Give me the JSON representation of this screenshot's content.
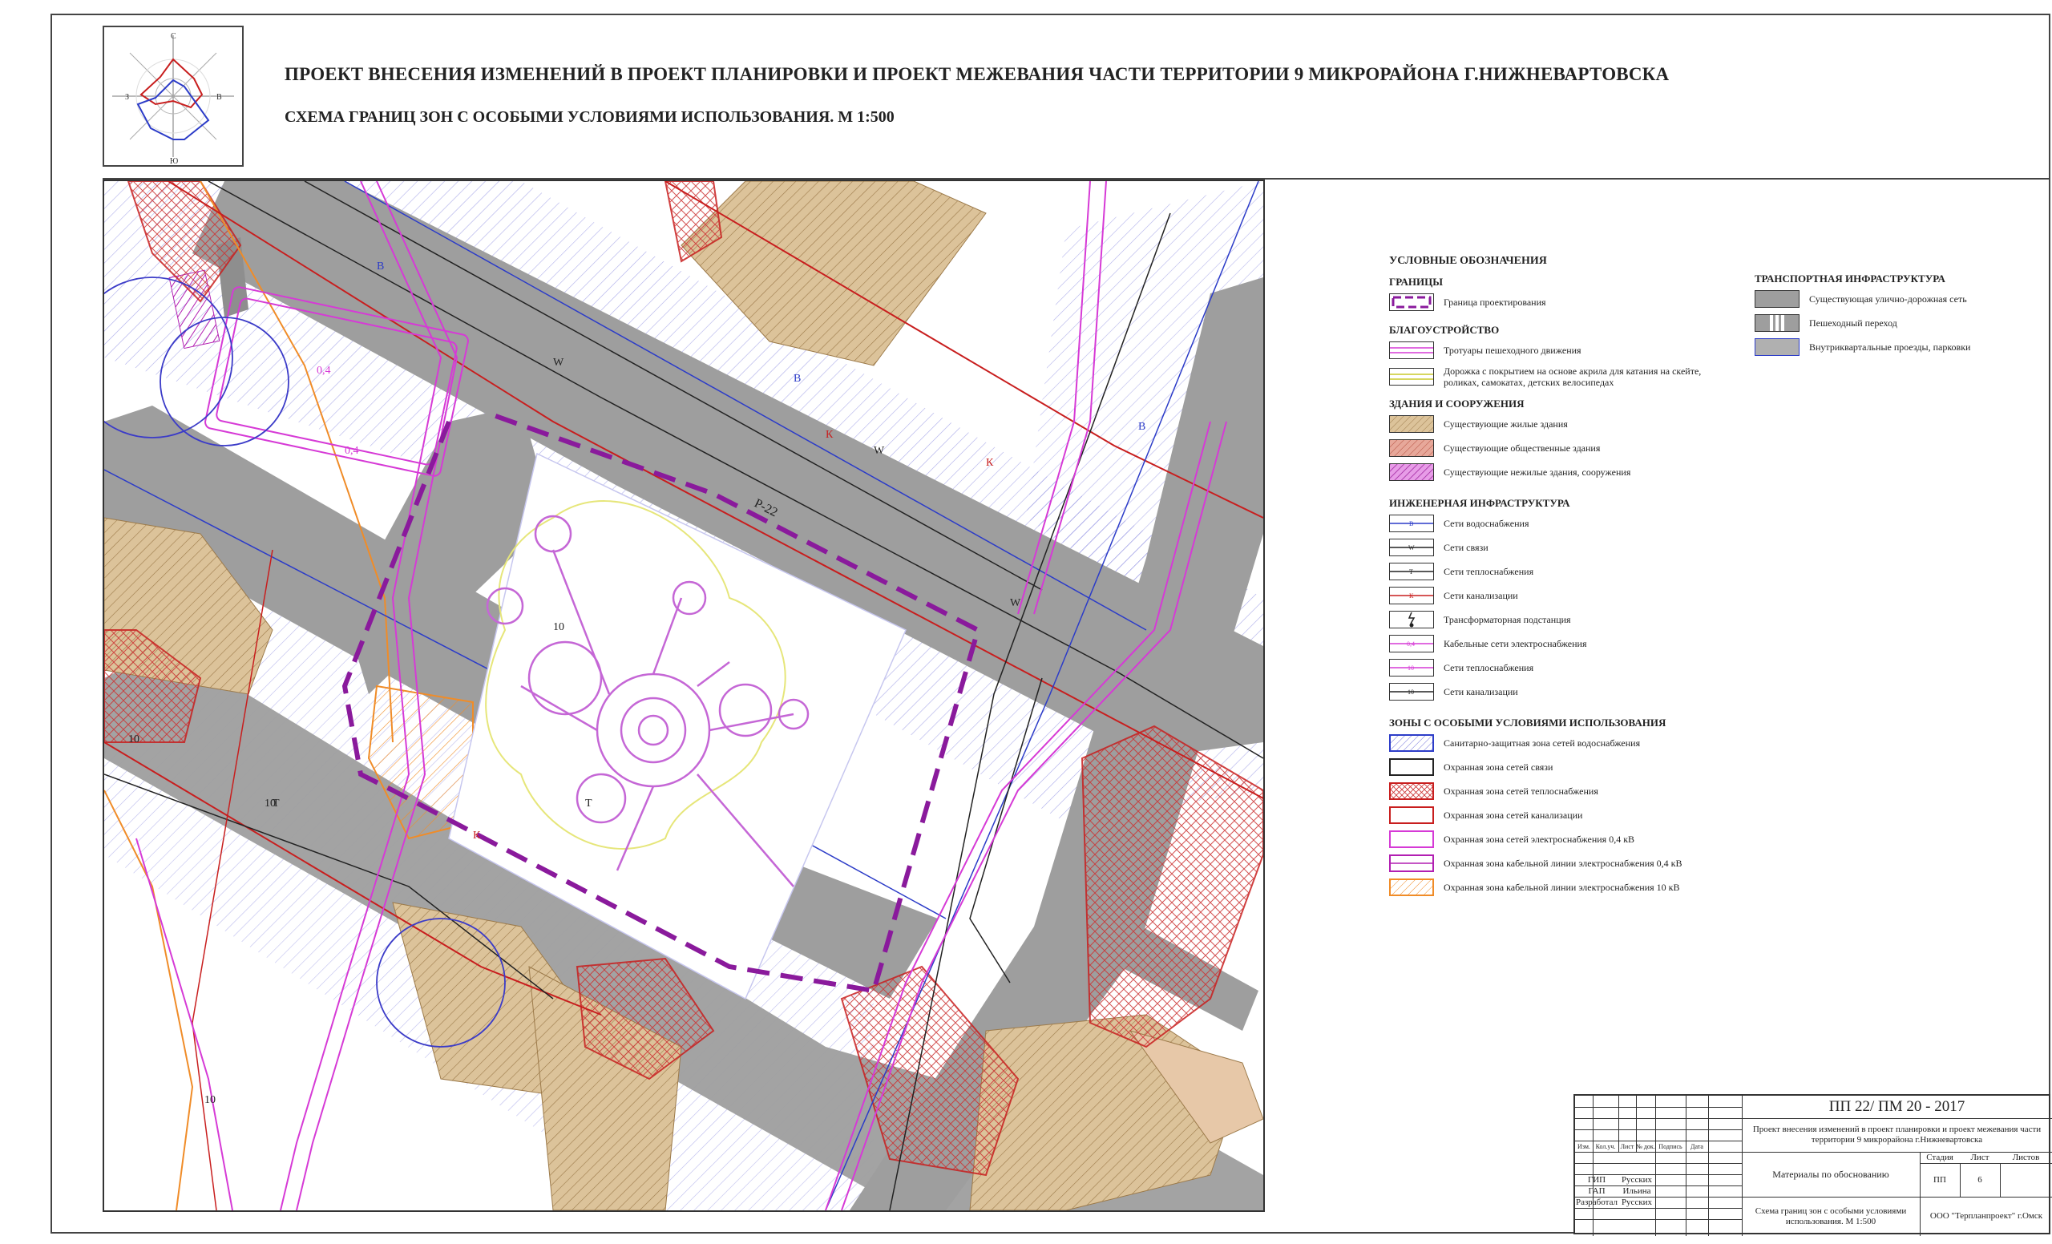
{
  "header": {
    "title": "ПРОЕКТ ВНЕСЕНИЯ ИЗМЕНЕНИЙ В ПРОЕКТ ПЛАНИРОВКИ И ПРОЕКТ МЕЖЕВАНИЯ ЧАСТИ ТЕРРИТОРИИ 9 МИКРОРАЙОНА Г.НИЖНЕВАРТОВСКА",
    "subtitle": "СХЕМА ГРАНИЦ ЗОН С ОСОБЫМИ УСЛОВИЯМИ ИСПОЛЬЗОВАНИЯ. М 1:500"
  },
  "compass": {
    "north": "С",
    "south": "Ю",
    "west": "З",
    "east": "В"
  },
  "map": {
    "street_label": "Р-22",
    "labels": {
      "water": "В",
      "comm": "W",
      "heat": "Т",
      "sewer": "К",
      "cable_04": "0,4",
      "cable_10": "10"
    }
  },
  "legend": {
    "title": "УСЛОВНЫЕ ОБОЗНАЧЕНИЯ",
    "sections": [
      {
        "heading": "ГРАНИЦЫ",
        "items": [
          {
            "label": "Граница проектирования",
            "swatch": "boundary"
          }
        ]
      },
      {
        "heading": "БЛАГОУСТРОЙСТВО",
        "items": [
          {
            "label": "Тротуары пешеходного движения",
            "swatch": "sidewalk"
          },
          {
            "label": "Дорожка с покрытием на основе акрила для катания на скейте, роликах, самокатах, детских велосипедах",
            "swatch": "acryl"
          }
        ]
      },
      {
        "heading": "ЗДАНИЯ И СООРУЖЕНИЯ",
        "items": [
          {
            "label": "Существующие жилые здания",
            "swatch": "residential"
          },
          {
            "label": "Существующие общественные здания",
            "swatch": "public"
          },
          {
            "label": "Существующие нежилые здания, сооружения",
            "swatch": "nonres"
          }
        ]
      },
      {
        "heading": "ИНЖЕНЕРНАЯ ИНФРАСТРУКТУРА",
        "items": [
          {
            "label": "Сети водоснабжения",
            "swatch": "line-water",
            "mark": "В"
          },
          {
            "label": "Сети связи",
            "swatch": "line-comm",
            "mark": "W"
          },
          {
            "label": "Сети теплоснабжения",
            "swatch": "line-heat",
            "mark": "Т"
          },
          {
            "label": "Сети канализации",
            "swatch": "line-sewer",
            "mark": "К"
          },
          {
            "label": "Трансформаторная подстанция",
            "swatch": "substation"
          },
          {
            "label": "Кабельные сети электроснабжения",
            "swatch": "line-cable",
            "mark": "0,4"
          },
          {
            "label": "Сети теплоснабжения",
            "swatch": "line-cable2",
            "mark": "10"
          },
          {
            "label": "Сети канализации",
            "swatch": "line-sewer2",
            "mark": "10"
          }
        ]
      },
      {
        "heading": "ЗОНЫ С ОСОБЫМИ УСЛОВИЯМИ ИСПОЛЬЗОВАНИЯ",
        "items": [
          {
            "label": "Санитарно-защитная зона сетей водоснабжения",
            "swatch": "z-water"
          },
          {
            "label": "Охранная зона сетей связи",
            "swatch": "z-comm"
          },
          {
            "label": "Охранная зона сетей теплоснабжения",
            "swatch": "z-heat"
          },
          {
            "label": "Охранная зона сетей канализации",
            "swatch": "z-sewer"
          },
          {
            "label": "Охранная зона сетей электроснабжения 0,4 кВ",
            "swatch": "z-el04"
          },
          {
            "label": "Охранная зона кабельной линии электроснабжения 0,4 кВ",
            "swatch": "z-cab04"
          },
          {
            "label": "Охранная зона кабельной линии электроснабжения 10 кВ",
            "swatch": "z-cab10"
          }
        ]
      }
    ],
    "transport": {
      "heading": "ТРАНСПОРТНАЯ ИНФРАСТРУКТУРА",
      "items": [
        {
          "label": "Существующая улично-дорожная сеть",
          "swatch": "road"
        },
        {
          "label": "Пешеходный переход",
          "swatch": "crossing"
        },
        {
          "label": "Внутриквартальные проезды, парковки",
          "swatch": "drive"
        }
      ]
    }
  },
  "stamp": {
    "code": "ПП 22/ ПМ 20 - 2017",
    "project": "Проект внесения изменений в проект планировки и проект межевания части территории 9 микрорайона г.Нижневартовска",
    "materials": "Материалы по обоснованию",
    "sheet_name": "Схема границ зон с особыми условиями использования. М 1:500",
    "org": "ООО \"Терпланпроект\" г.Омск",
    "col_headers": [
      "Изм.",
      "Кол.уч.",
      "Лист",
      "№ док.",
      "Подпись",
      "Дата"
    ],
    "stage_headers": [
      "Стадия",
      "Лист",
      "Листов"
    ],
    "stage_values": [
      "ПП",
      "6",
      ""
    ],
    "roles": [
      {
        "role": "ГИП",
        "name": "Русских"
      },
      {
        "role": "ГАП",
        "name": "Ильина"
      },
      {
        "role": "Разработал",
        "name": "Русских"
      }
    ]
  },
  "colors": {
    "road": "#9e9e9e",
    "residential": "#d8bf98",
    "public": "#e7a89a",
    "water": "#2c3cc8",
    "sewer": "#c81e1e",
    "electric": "#d63ad6",
    "cable10": "#f08c28",
    "boundary": "#8a1a9c"
  }
}
